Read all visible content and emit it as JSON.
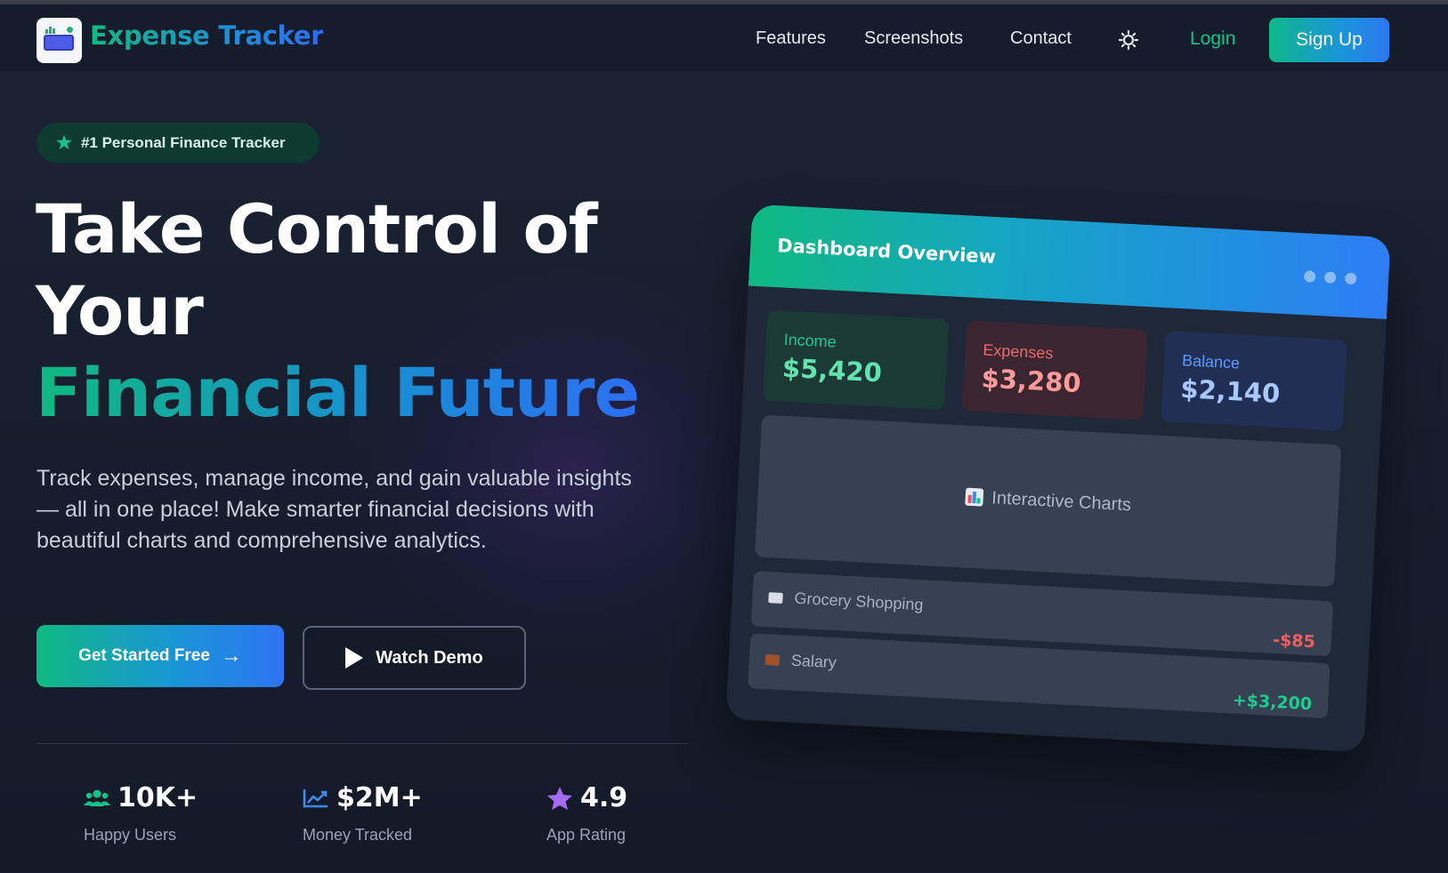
{
  "nav": {
    "brand": "Expense Tracker",
    "links": [
      "Features",
      "Screenshots",
      "Contact"
    ],
    "theme_toggle_icon": "sun-icon",
    "login_label": "Login",
    "signup_label": "Sign Up"
  },
  "hero": {
    "badge": "#1 Personal Finance Tracker",
    "headline_line1": "Take Control of",
    "headline_line2": "Your",
    "headline_line3": "Financial Future",
    "description": "Track expenses, manage income, and gain valuable insights — all in one place! Make smarter financial decisions with beautiful charts and comprehensive analytics.",
    "primary_cta": "Get Started Free",
    "secondary_cta": "Watch Demo",
    "stats": [
      {
        "icon": "users-icon",
        "value": "10K+",
        "label": "Happy Users"
      },
      {
        "icon": "chart-line-icon",
        "value": "$2M+",
        "label": "Money Tracked"
      },
      {
        "icon": "star-icon",
        "value": "4.9",
        "label": "App Rating"
      }
    ]
  },
  "dashboard": {
    "title": "Dashboard Overview",
    "kpis": {
      "income": {
        "label": "Income",
        "value": "$5,420"
      },
      "expenses": {
        "label": "Expenses",
        "value": "$3,280"
      },
      "balance": {
        "label": "Balance",
        "value": "$2,140"
      }
    },
    "chart_placeholder": "Interactive Charts",
    "transactions": [
      {
        "name": "Grocery Shopping",
        "amount": "-$85"
      },
      {
        "name": "Salary",
        "amount": "+$3,200"
      }
    ]
  },
  "colors": {
    "accent_green": "#10b981",
    "accent_blue": "#2f6bf0",
    "background": "#151c2b"
  }
}
